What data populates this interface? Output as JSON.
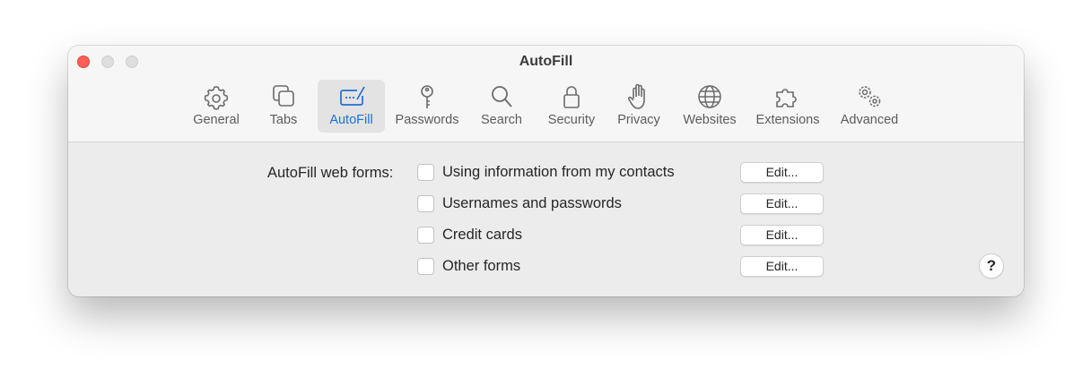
{
  "window": {
    "title": "AutoFill"
  },
  "toolbar": {
    "tabs": [
      {
        "label": "General",
        "icon": "gear-icon"
      },
      {
        "label": "Tabs",
        "icon": "tabs-icon"
      },
      {
        "label": "AutoFill",
        "icon": "autofill-icon",
        "selected": true
      },
      {
        "label": "Passwords",
        "icon": "key-icon"
      },
      {
        "label": "Search",
        "icon": "magnifier-icon"
      },
      {
        "label": "Security",
        "icon": "lock-icon"
      },
      {
        "label": "Privacy",
        "icon": "hand-icon"
      },
      {
        "label": "Websites",
        "icon": "globe-icon"
      },
      {
        "label": "Extensions",
        "icon": "puzzle-icon"
      },
      {
        "label": "Advanced",
        "icon": "gears-icon"
      }
    ]
  },
  "autofill": {
    "label": "AutoFill web forms:",
    "options": [
      {
        "label": "Using information from my contacts",
        "checked": false,
        "button": "Edit..."
      },
      {
        "label": "Usernames and passwords",
        "checked": false,
        "button": "Edit..."
      },
      {
        "label": "Credit cards",
        "checked": false,
        "button": "Edit..."
      },
      {
        "label": "Other forms",
        "checked": false,
        "button": "Edit..."
      }
    ]
  },
  "help": {
    "label": "?"
  },
  "colors": {
    "accent": "#1e6fd9",
    "close": "#fe5f57"
  }
}
